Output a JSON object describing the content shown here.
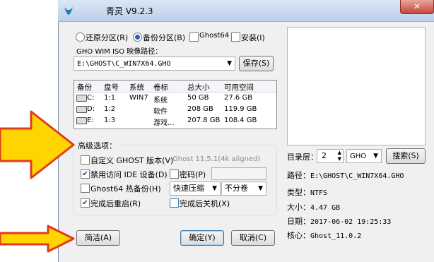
{
  "window": {
    "title": "青灵 V9.2.3",
    "close_glyph": "✕"
  },
  "mode": {
    "restore_label": "还原分区(R)",
    "backup_label": "备份分区(B)",
    "selected": "backup",
    "ghost64_label": "Ghost64",
    "install_label": "安装(I)"
  },
  "path": {
    "label": "GHO WIM ISO 映像路径：",
    "value": "E:\\GHOST\\C_WIN7X64.GHO",
    "save_label": "保存(S)"
  },
  "partitions": {
    "columns": [
      "备份",
      "盘号",
      "系统",
      "卷标",
      "总大小",
      "可用空间"
    ],
    "rows": [
      {
        "drive": "C:",
        "disk": "1:1",
        "system": "WIN7",
        "label": "系统",
        "total": "50 GB",
        "free": "27.6 GB"
      },
      {
        "drive": "D:",
        "disk": "1:2",
        "system": "",
        "label": "软件",
        "total": "208 GB",
        "free": "119.9 GB"
      },
      {
        "drive": "E:",
        "disk": "1:3",
        "system": "",
        "label": "游戏...",
        "total": "207.8 GB",
        "free": "108.4 GB"
      }
    ]
  },
  "advanced": {
    "title": "高级选项：",
    "custom_ghost_label": "自定义 GHOST 版本(V)",
    "ghost_version_value": "Ghost 11.5.1(4k aligned)",
    "disable_ide_label": "禁用访问 IDE 设备(D)",
    "password_label": "密码(P)",
    "ghost64_hot_label": "Ghost64 热备份(H)",
    "compression_value": "快速压缩",
    "split_value": "不分卷",
    "reboot_label": "完成后重启(R)",
    "shutdown_label": "完成后关机(X)"
  },
  "buttons": {
    "simple": "简洁(A)",
    "ok": "确定(Y)",
    "cancel": "取消(C)",
    "search": "搜索(S)"
  },
  "directory": {
    "label": "目录层：",
    "level": "2",
    "type": "GHO"
  },
  "info": {
    "path_label": "路径：",
    "path_value": "E:\\GHOST\\C_WIN7X64.GHO",
    "type_label": "类型：",
    "type_value": "NTFS",
    "size_label": "大小：",
    "size_value": "4.47 GB",
    "date_label": "日期：",
    "date_value": "2017-06-02  19:25:33",
    "core_label": "核心：",
    "core_value": "Ghost_11.0.2"
  },
  "colors": {
    "arrow_fill": "#ffd400",
    "arrow_stroke": "#e23b1b",
    "accent": "#2a5bd6"
  }
}
